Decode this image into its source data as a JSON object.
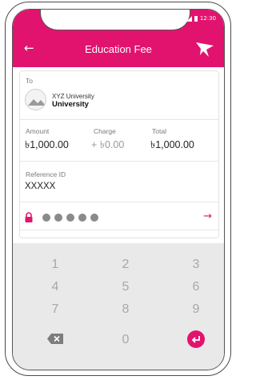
{
  "status_bar": {
    "time": "12:30"
  },
  "header": {
    "back_icon": "back-arrow-icon",
    "title": "Education Fee",
    "logo_icon": "bird-logo-icon"
  },
  "recipient": {
    "label": "To",
    "name_line1": "XYZ University",
    "name_line2": "University"
  },
  "amounts": {
    "amount_label": "Amount",
    "amount_value": "৳1,000.00",
    "charge_label": "Charge",
    "charge_value": "+ ৳0.00",
    "total_label": "Total",
    "total_value": "৳1,000.00"
  },
  "reference": {
    "label": "Reference ID",
    "value": "XXXXX"
  },
  "pin": {
    "masked_digits": 5
  },
  "keypad": {
    "keys": [
      "1",
      "2",
      "3",
      "4",
      "5",
      "6",
      "7",
      "8",
      "9",
      "0"
    ],
    "delete_icon": "backspace-icon",
    "enter_icon": "enter-icon"
  },
  "colors": {
    "brand": "#e2136e"
  }
}
